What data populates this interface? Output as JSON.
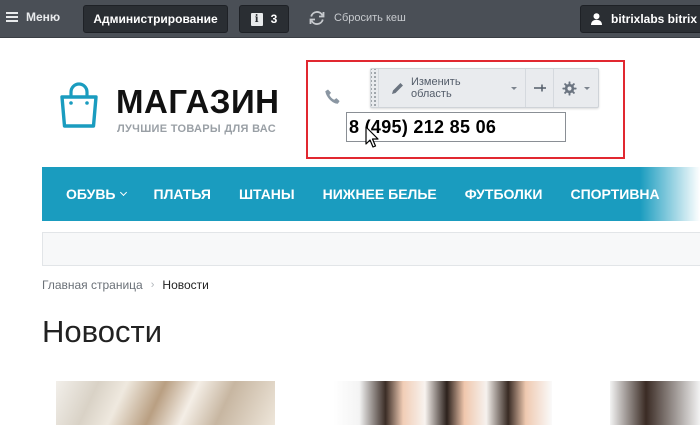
{
  "adminbar": {
    "menu_label": "Меню",
    "admin_label": "Администрирование",
    "notifications_count": "3",
    "reset_cache_label": "Сбросить кеш",
    "user_label": "bitrixlabs bitrix"
  },
  "header": {
    "logo_name": "МАГАЗИН",
    "logo_tagline": "ЛУЧШИЕ ТОВАРЫ ДЛЯ ВАС"
  },
  "edit_area": {
    "change_area_label": "Изменить область",
    "phone_value": "8 (495) 212 85 06",
    "highlight_color": "#e12830"
  },
  "nav": {
    "items": [
      "ОБУВЬ",
      "ПЛАТЬЯ",
      "ШТАНЫ",
      "НИЖНЕЕ БЕЛЬЕ",
      "ФУТБОЛКИ",
      "СПОРТИВНА"
    ],
    "background_color": "#1a9cbf"
  },
  "breadcrumb": {
    "home": "Главная страница",
    "current": "Новости"
  },
  "page": {
    "title": "Новости"
  }
}
